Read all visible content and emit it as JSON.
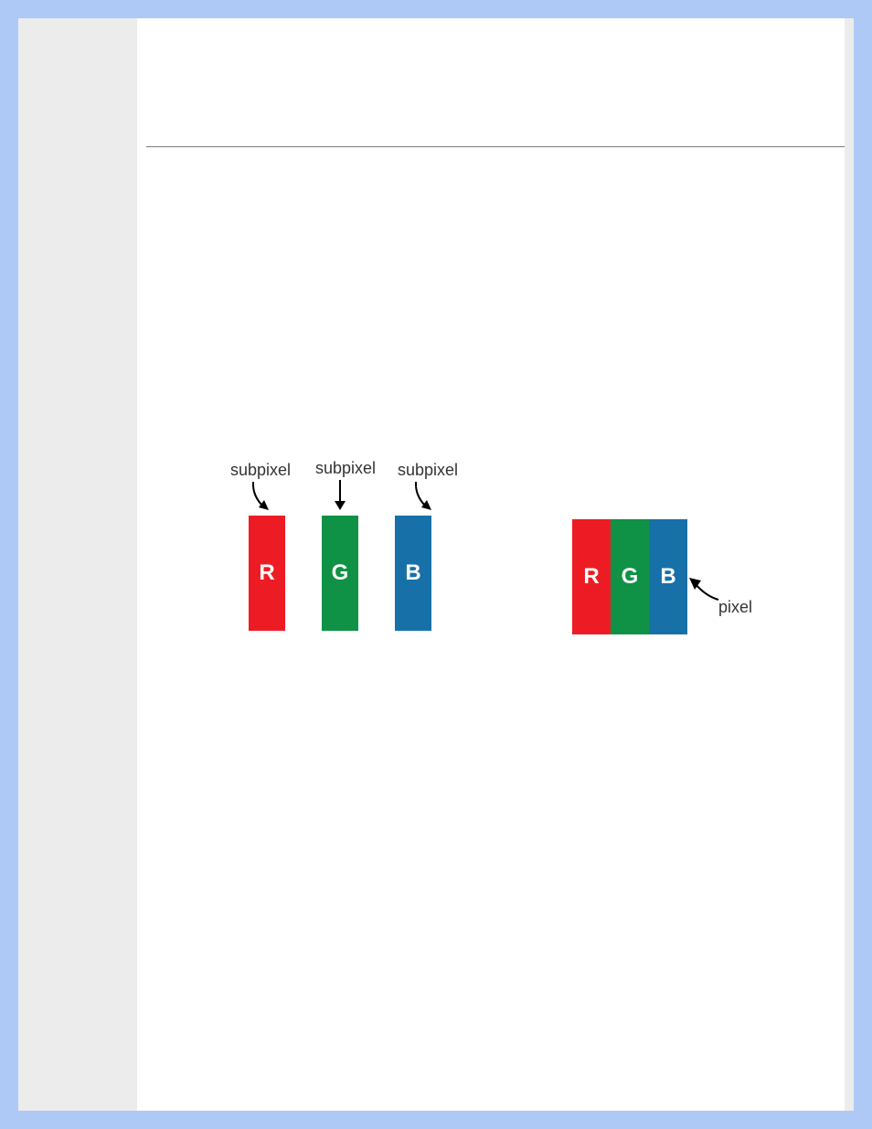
{
  "labels": {
    "sub1": "subpixel",
    "sub2": "subpixel",
    "sub3": "subpixel",
    "pixel": "pixel"
  },
  "letters": {
    "r": "R",
    "g": "G",
    "b": "B"
  },
  "colors": {
    "red": "#ed1c24",
    "green": "#0f9245",
    "blue": "#1771a8"
  }
}
